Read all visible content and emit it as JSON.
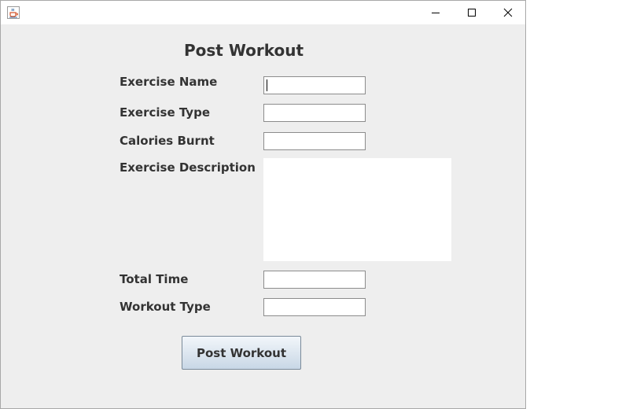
{
  "window": {
    "controls": {
      "minimize_icon": "minimize-icon",
      "maximize_icon": "maximize-icon",
      "close_icon": "close-icon"
    },
    "app_icon": "java-coffee-cup-icon"
  },
  "form": {
    "heading": "Post Workout",
    "fields": {
      "exercise_name": {
        "label": "Exercise Name",
        "value": ""
      },
      "exercise_type": {
        "label": "Exercise Type",
        "value": ""
      },
      "calories_burnt": {
        "label": "Calories Burnt",
        "value": ""
      },
      "exercise_description": {
        "label": "Exercise Description",
        "value": ""
      },
      "total_time": {
        "label": "Total Time",
        "value": ""
      },
      "workout_type": {
        "label": "Workout Type",
        "value": ""
      }
    },
    "submit_label": "Post Workout"
  },
  "colors": {
    "window_background": "#eeeeee",
    "titlebar_background": "#ffffff",
    "label_text": "#333333",
    "button_gradient_top": "#f2f6fa",
    "button_gradient_bottom": "#c8d7e6"
  }
}
